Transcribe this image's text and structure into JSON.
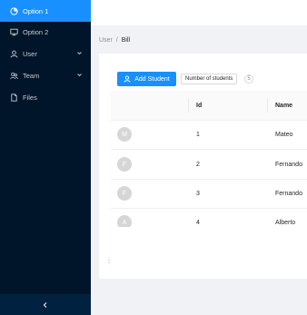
{
  "sidebar": {
    "items": [
      {
        "label": "Option 1",
        "icon": "pie-chart-icon",
        "active": true
      },
      {
        "label": "Option 2",
        "icon": "desktop-icon"
      },
      {
        "label": "User",
        "icon": "user-icon",
        "submenu": true
      },
      {
        "label": "Team",
        "icon": "team-icon",
        "submenu": true
      },
      {
        "label": "Files",
        "icon": "file-icon"
      }
    ],
    "collapse_icon": "chevron-left-icon"
  },
  "breadcrumb": {
    "items": [
      "User",
      "Bill"
    ],
    "separator": "/"
  },
  "toolbar": {
    "add_label": "Add Student",
    "number_label": "Number of students",
    "count": "5"
  },
  "table": {
    "columns": [
      "",
      "Id",
      "Name"
    ],
    "rows": [
      {
        "avatar": "M",
        "id": "1",
        "name": "Mateo"
      },
      {
        "avatar": "F",
        "id": "2",
        "name": "Fernando"
      },
      {
        "avatar": "F",
        "id": "3",
        "name": "Fernando"
      },
      {
        "avatar": "A",
        "id": "4",
        "name": "Alberto"
      }
    ]
  },
  "footer": {
    "text": ":"
  },
  "colors": {
    "sider": "#001529",
    "accent": "#1890ff",
    "trigger": "#002140"
  }
}
